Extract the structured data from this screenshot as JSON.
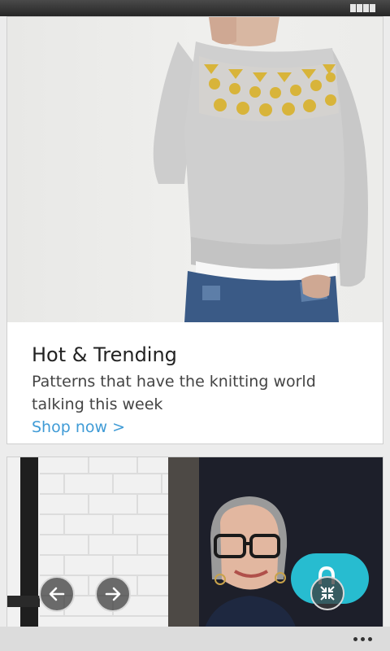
{
  "status_bar": {
    "battery_icon": "battery-icon"
  },
  "cards": [
    {
      "image": "knitted-sweater-photo",
      "title": "Hot & Trending",
      "description": "Patterns that have the knitting world talking this week",
      "link": "Shop now >"
    },
    {
      "image": "designer-portrait-photo"
    }
  ],
  "carousel": {
    "prev_icon": "arrow-left-icon",
    "next_icon": "arrow-right-icon"
  },
  "fab": {
    "icon": "lock-icon",
    "collapse_icon": "collapse-icon"
  },
  "app_bar": {
    "more_icon": "more-icon"
  },
  "colors": {
    "link": "#3f9bd6",
    "fab": "#27bcd0",
    "title": "#222222",
    "text": "#444444"
  }
}
